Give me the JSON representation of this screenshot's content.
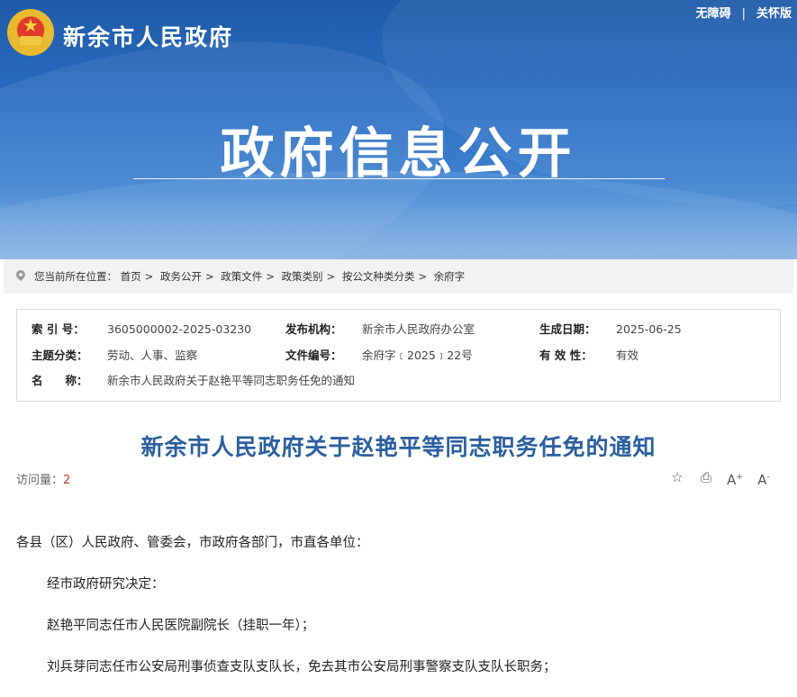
{
  "header": {
    "site_name": "新余市人民政府",
    "links": [
      "无障碍",
      "关怀版"
    ],
    "separator": "|",
    "hero_title": "政府信息公开"
  },
  "breadcrumb": {
    "prefix": "您当前所在位置：",
    "items": [
      "首页",
      "政务公开",
      "政策文件",
      "政策类别",
      "按公文种类分类",
      "余府字"
    ],
    "arrow": ">"
  },
  "meta": {
    "index_no": {
      "label": "索 引 号：",
      "value": "3605000002-2025-03230"
    },
    "publisher": {
      "label": "发布机构：",
      "value": "新余市人民政府办公室"
    },
    "created": {
      "label": "生成日期：",
      "value": "2025-06-25"
    },
    "topic": {
      "label": "主题分类：",
      "value": "劳动、人事、监察"
    },
    "doc_no": {
      "label": "文件编号：",
      "value": "余府字﹝2025﹞22号"
    },
    "validity": {
      "label": "有 效 性：",
      "value": "有效"
    },
    "name": {
      "label": "名　　称：",
      "value": "新余市人民政府关于赵艳平等同志职务任免的通知"
    }
  },
  "document": {
    "title": "新余市人民政府关于赵艳平等同志职务任免的通知",
    "visits_label": "访问量：",
    "visits_value": "2",
    "paragraphs": [
      "各县（区）人民政府、管委会，市政府各部门，市直各单位：",
      "经市政府研究决定：",
      "赵艳平同志任市人民医院副院长（挂职一年）；",
      "刘兵芽同志任市公安局刑事侦查支队支队长，免去其市公安局刑事警察支队支队长职务；"
    ]
  },
  "tools": {
    "favorite_icon": "star-icon",
    "print_icon": "printer-icon",
    "font_up_label": "A",
    "font_down_label": "A"
  }
}
